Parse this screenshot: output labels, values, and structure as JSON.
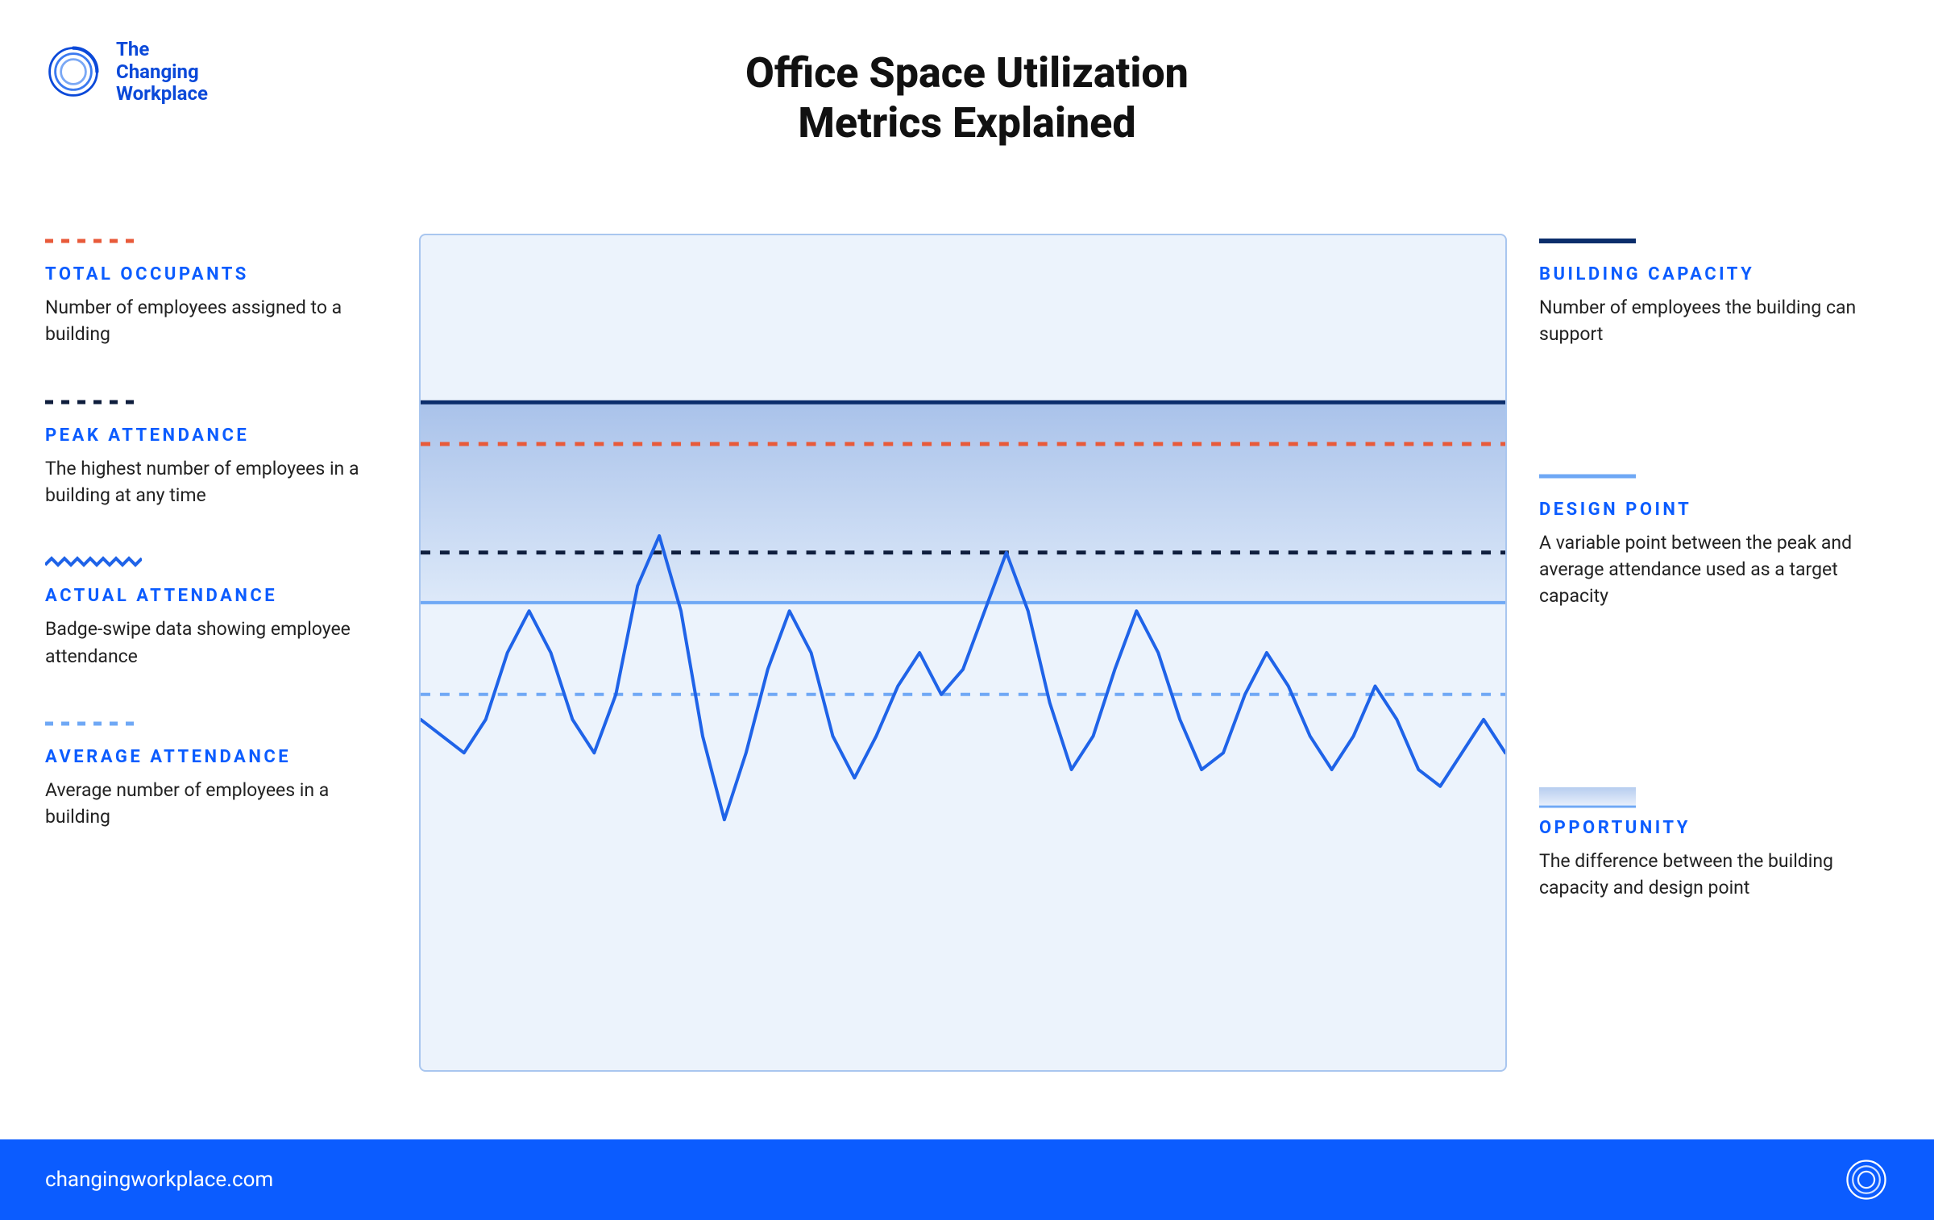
{
  "brand": {
    "name_line1": "The",
    "name_line2": "Changing",
    "name_line3": "Workplace"
  },
  "title_line1": "Office Space Utilization",
  "title_line2": "Metrics Explained",
  "legend_left": [
    {
      "label": "TOTAL OCCUPANTS",
      "desc": "Number of employees assigned to a building",
      "swatch": "dashed-red"
    },
    {
      "label": "PEAK ATTENDANCE",
      "desc": "The highest number of employees in a building at any time",
      "swatch": "dashed-dark"
    },
    {
      "label": "ACTUAL ATTENDANCE",
      "desc": "Badge-swipe data showing employee attendance",
      "swatch": "wave-blue"
    },
    {
      "label": "AVERAGE ATTENDANCE",
      "desc": "Average number of employees in a building",
      "swatch": "dashed-light-blue"
    }
  ],
  "legend_right": [
    {
      "label": "BUILDING CAPACITY",
      "desc": "Number of employees the building can support",
      "swatch": "solid-dark-blue"
    },
    {
      "label": "DESIGN POINT",
      "desc": "A variable point between the peak and average attendance used as a target capacity",
      "swatch": "solid-mid-blue"
    },
    {
      "label": "OPPORTUNITY",
      "desc": "The difference between the building capacity and design point",
      "swatch": "gradient-band"
    }
  ],
  "footer": {
    "url": "changingworkplace.com"
  },
  "chart_data": {
    "type": "line",
    "title": "Office Space Utilization Metrics Explained",
    "xlabel": "",
    "ylabel": "",
    "ylim": [
      0,
      100
    ],
    "reference_lines": {
      "building_capacity": 80,
      "total_occupants": 75,
      "peak_attendance": 62,
      "design_point": 56,
      "average_attendance": 45
    },
    "series": [
      {
        "name": "Actual Attendance",
        "x": [
          0,
          2,
          4,
          6,
          8,
          10,
          12,
          14,
          16,
          18,
          20,
          22,
          24,
          26,
          28,
          30,
          32,
          34,
          36,
          38,
          40,
          42,
          44,
          46,
          48,
          50,
          52,
          54,
          56,
          58,
          60,
          62,
          64,
          66,
          68,
          70,
          72,
          74,
          76,
          78,
          80,
          82,
          84,
          86,
          88,
          90,
          92,
          94,
          96,
          98,
          100
        ],
        "values": [
          42,
          40,
          38,
          42,
          50,
          55,
          50,
          42,
          38,
          45,
          58,
          64,
          55,
          40,
          30,
          38,
          48,
          55,
          50,
          40,
          35,
          40,
          46,
          50,
          45,
          48,
          55,
          62,
          55,
          44,
          36,
          40,
          48,
          55,
          50,
          42,
          36,
          38,
          45,
          50,
          46,
          40,
          36,
          40,
          46,
          42,
          36,
          34,
          38,
          42,
          38
        ]
      }
    ],
    "opportunity_band": {
      "from": "design_point",
      "to": "building_capacity"
    }
  }
}
